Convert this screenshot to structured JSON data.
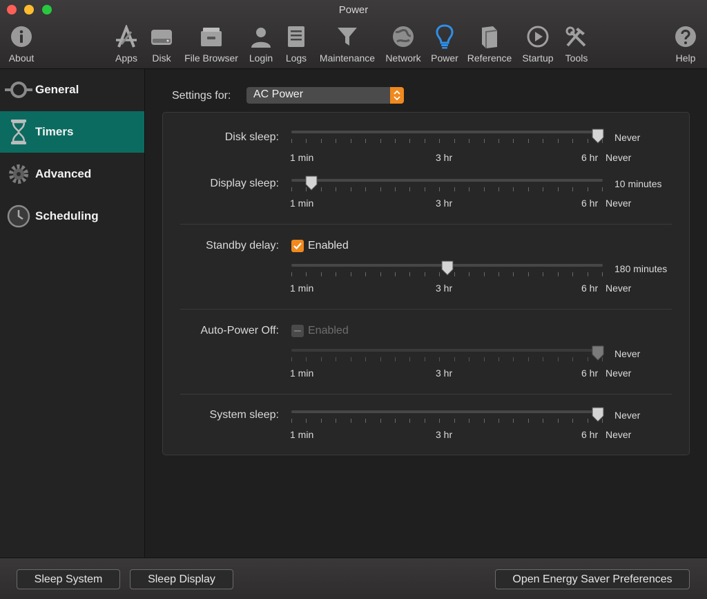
{
  "window": {
    "title": "Power"
  },
  "toolbar": {
    "items": [
      {
        "label": "About",
        "icon": "info-icon"
      },
      {
        "label": "Apps",
        "icon": "apps-icon"
      },
      {
        "label": "Disk",
        "icon": "disk-icon"
      },
      {
        "label": "File Browser",
        "icon": "file-cabinet-icon"
      },
      {
        "label": "Login",
        "icon": "user-icon"
      },
      {
        "label": "Logs",
        "icon": "logs-icon"
      },
      {
        "label": "Maintenance",
        "icon": "funnel-icon"
      },
      {
        "label": "Network",
        "icon": "globe-icon"
      },
      {
        "label": "Power",
        "icon": "lightbulb-icon",
        "selected": true
      },
      {
        "label": "Reference",
        "icon": "book-icon"
      },
      {
        "label": "Startup",
        "icon": "play-icon"
      },
      {
        "label": "Tools",
        "icon": "tools-icon"
      },
      {
        "label": "Help",
        "icon": "help-icon"
      }
    ]
  },
  "sidebar": {
    "items": [
      {
        "label": "General",
        "icon": "power-plug-icon"
      },
      {
        "label": "Timers",
        "icon": "hourglass-icon",
        "selected": true
      },
      {
        "label": "Advanced",
        "icon": "gear-icon"
      },
      {
        "label": "Scheduling",
        "icon": "clock-icon"
      }
    ]
  },
  "settings": {
    "label": "Settings for:",
    "selected": "AC Power"
  },
  "scale_labels": {
    "min": "1 min",
    "mid": "3 hr",
    "max": "6 hr",
    "never": "Never"
  },
  "rows": {
    "disk_sleep": {
      "label": "Disk sleep:",
      "value": "Never",
      "position": 1.0
    },
    "display_sleep": {
      "label": "Display sleep:",
      "value": "10 minutes",
      "position": 0.05
    },
    "standby_delay": {
      "label": "Standby delay:",
      "checkbox": "Enabled",
      "checked": true,
      "value": "180 minutes",
      "position": 0.5
    },
    "auto_power_off": {
      "label": "Auto-Power Off:",
      "checkbox": "Enabled",
      "checked": false,
      "disabled": true,
      "value": "Never",
      "position": 1.0
    },
    "system_sleep": {
      "label": "System sleep:",
      "value": "Never",
      "position": 1.0
    }
  },
  "buttons": {
    "sleep_system": "Sleep System",
    "sleep_display": "Sleep Display",
    "open_energy_saver": "Open Energy Saver Preferences"
  },
  "colors": {
    "accent": "#f0891e",
    "sidebar_selected": "#0b6b60",
    "power_icon": "#2f8fe8"
  }
}
